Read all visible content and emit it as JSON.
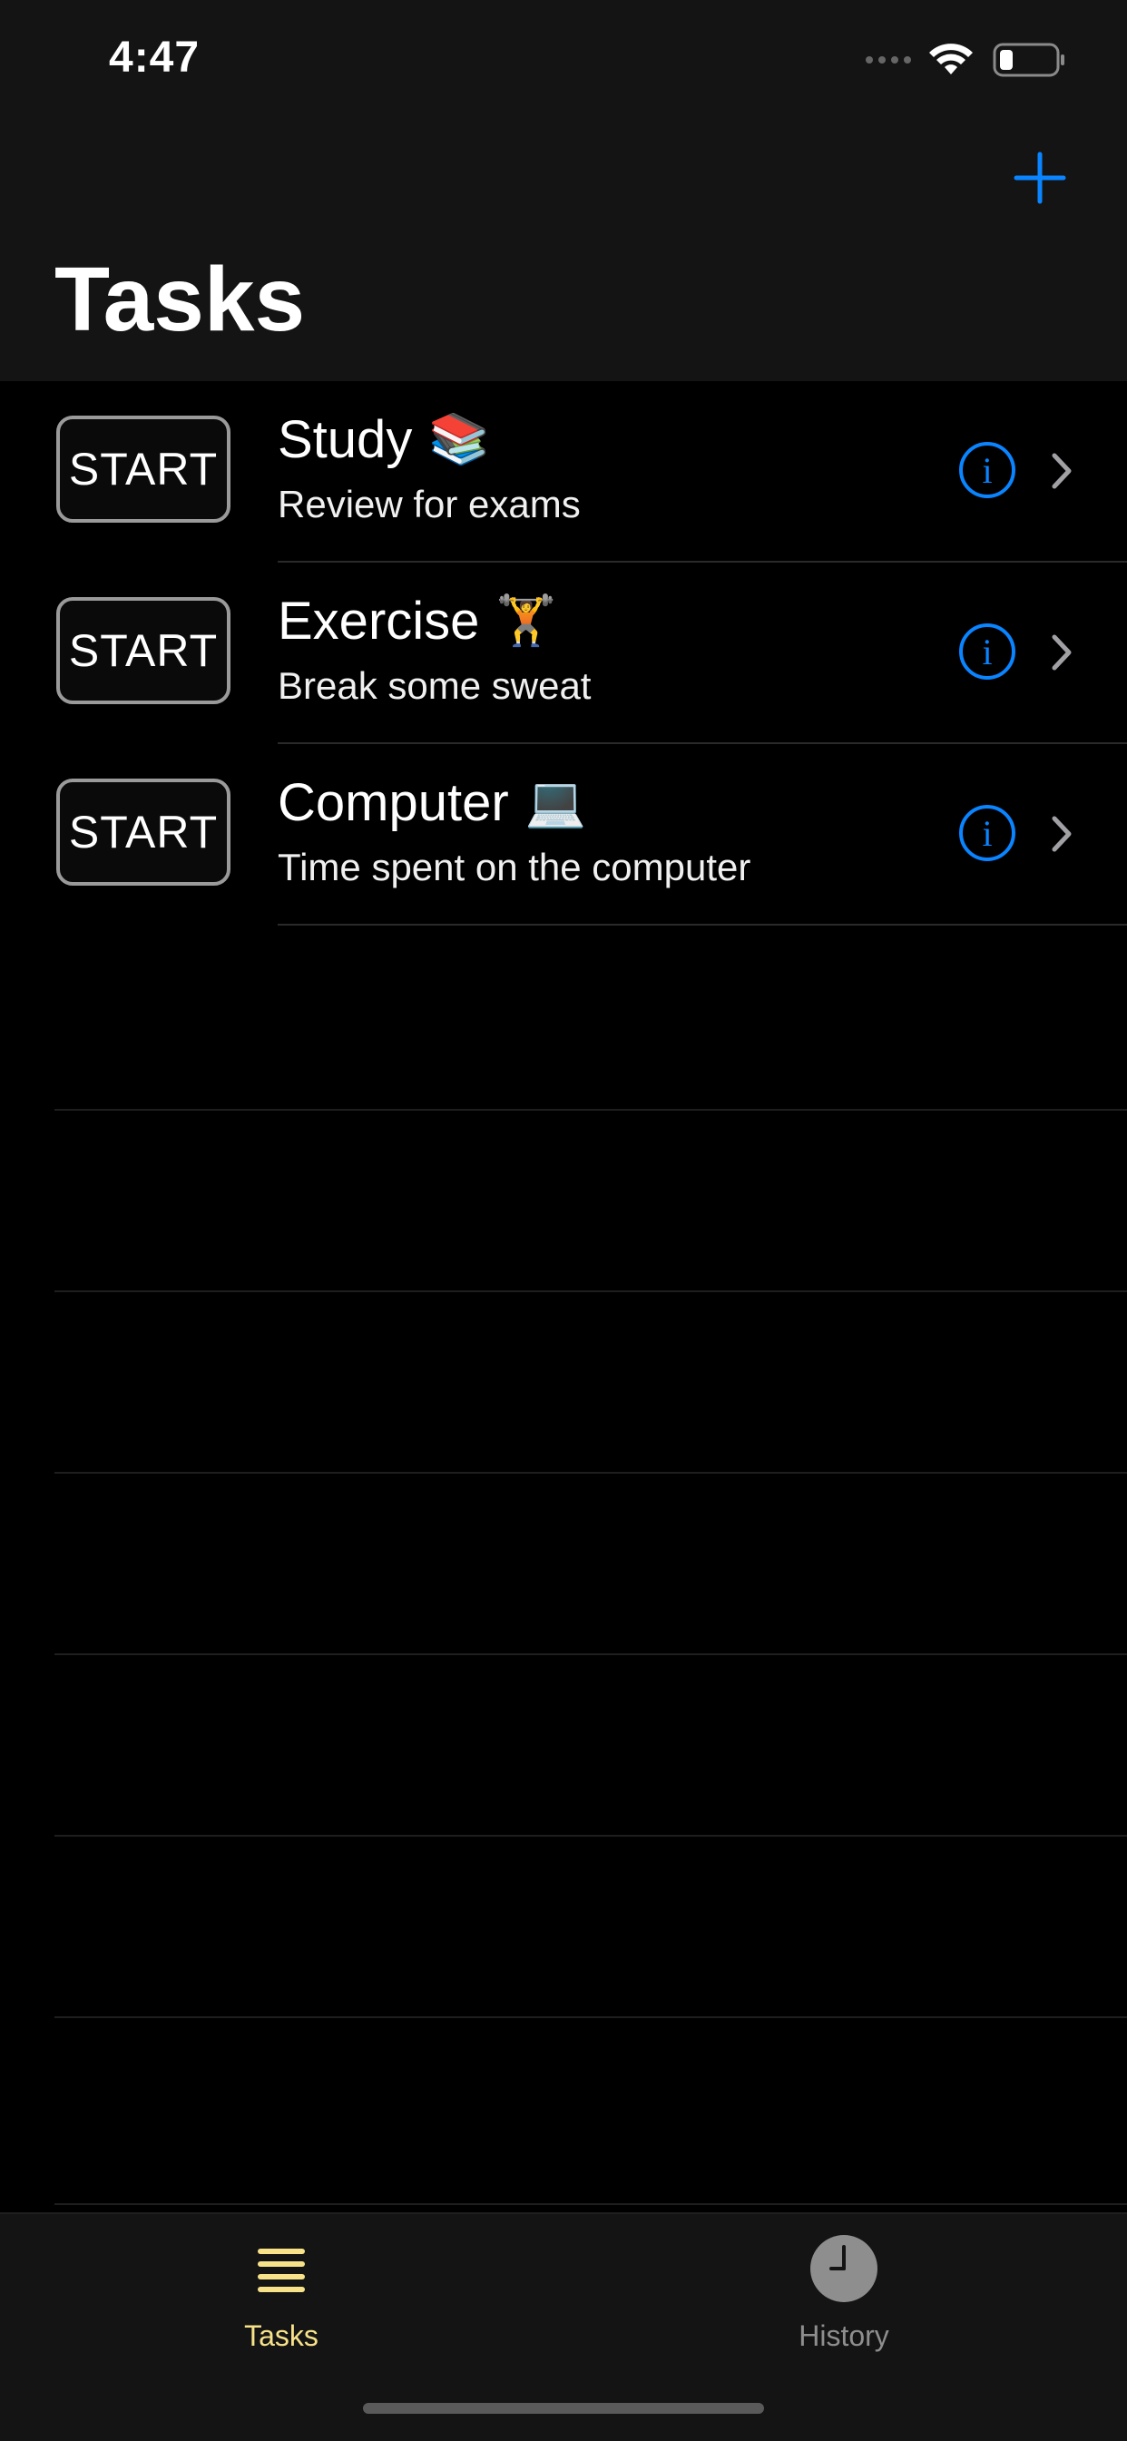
{
  "status_bar": {
    "time": "4:47"
  },
  "header": {
    "title": "Tasks"
  },
  "tasks": [
    {
      "title": "Study",
      "emoji": "📚",
      "subtitle": "Review for exams",
      "button": "START"
    },
    {
      "title": "Exercise",
      "emoji": "🏋️",
      "subtitle": "Break some sweat",
      "button": "START"
    },
    {
      "title": "Computer",
      "emoji": "💻",
      "subtitle": "Time spent on the computer",
      "button": "START"
    }
  ],
  "tab_bar": {
    "tabs": [
      {
        "label": "Tasks",
        "icon": "list-icon",
        "active": true
      },
      {
        "label": "History",
        "icon": "clock-icon",
        "active": false
      }
    ]
  },
  "colors": {
    "accent_blue": "#0a84ff",
    "active_tab": "#f7e28a",
    "inactive_tab": "#8e8e8e"
  }
}
